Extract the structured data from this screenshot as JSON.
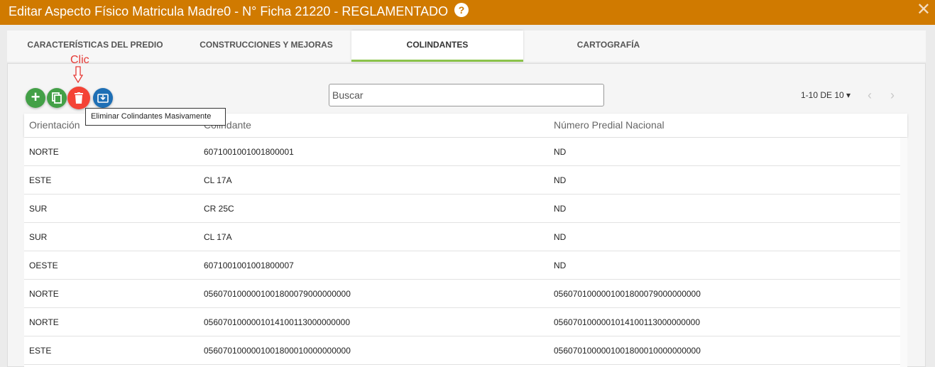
{
  "window": {
    "title": "Editar Aspecto Físico Matricula Madre0 - N° Ficha 21220 - REGLAMENTADO",
    "help_glyph": "?",
    "close_glyph": "✕"
  },
  "tabs": [
    {
      "label": "CARACTERÍSTICAS DEL PREDIO"
    },
    {
      "label": "CONSTRUCCIONES Y MEJORAS"
    },
    {
      "label": "COLINDANTES",
      "active": true
    },
    {
      "label": "CARTOGRAFÍA"
    }
  ],
  "toolbar": {
    "add_glyph": "+",
    "annotation": "Clic",
    "tooltip": "Eliminar Colindantes Masivamente",
    "icons": {
      "add": "plus-icon",
      "copy": "copy-icon",
      "delete": "trash-icon",
      "import": "import-icon"
    },
    "colors": {
      "add": "#43a047",
      "copy": "#43a047",
      "delete": "#f44336",
      "import": "#1e6fb5",
      "annotation": "#e53935"
    }
  },
  "search": {
    "placeholder": "Buscar",
    "value": ""
  },
  "pagination": {
    "label": "1-10 DE 10 ▾",
    "prev": "‹",
    "next": "›"
  },
  "table": {
    "headers": [
      "Orientación",
      "Colindante",
      "Número Predial Nacional"
    ],
    "rows": [
      [
        "NORTE",
        "6071001001001800001",
        "ND"
      ],
      [
        "ESTE",
        "CL 17A",
        "ND"
      ],
      [
        "SUR",
        "CR 25C",
        "ND"
      ],
      [
        "SUR",
        "CL 17A",
        "ND"
      ],
      [
        "OESTE",
        "6071001001001800007",
        "ND"
      ],
      [
        "NORTE",
        "0560701000001001800079000000000",
        "0560701000001001800079000000000"
      ],
      [
        "NORTE",
        "0560701000001014100113000000000",
        "0560701000001014100113000000000"
      ],
      [
        "ESTE",
        "0560701000001001800010000000000",
        "0560701000001001800010000000000"
      ]
    ]
  },
  "theme": {
    "header_bg": "#d07a00",
    "active_tab_underline": "#8bc34a"
  }
}
